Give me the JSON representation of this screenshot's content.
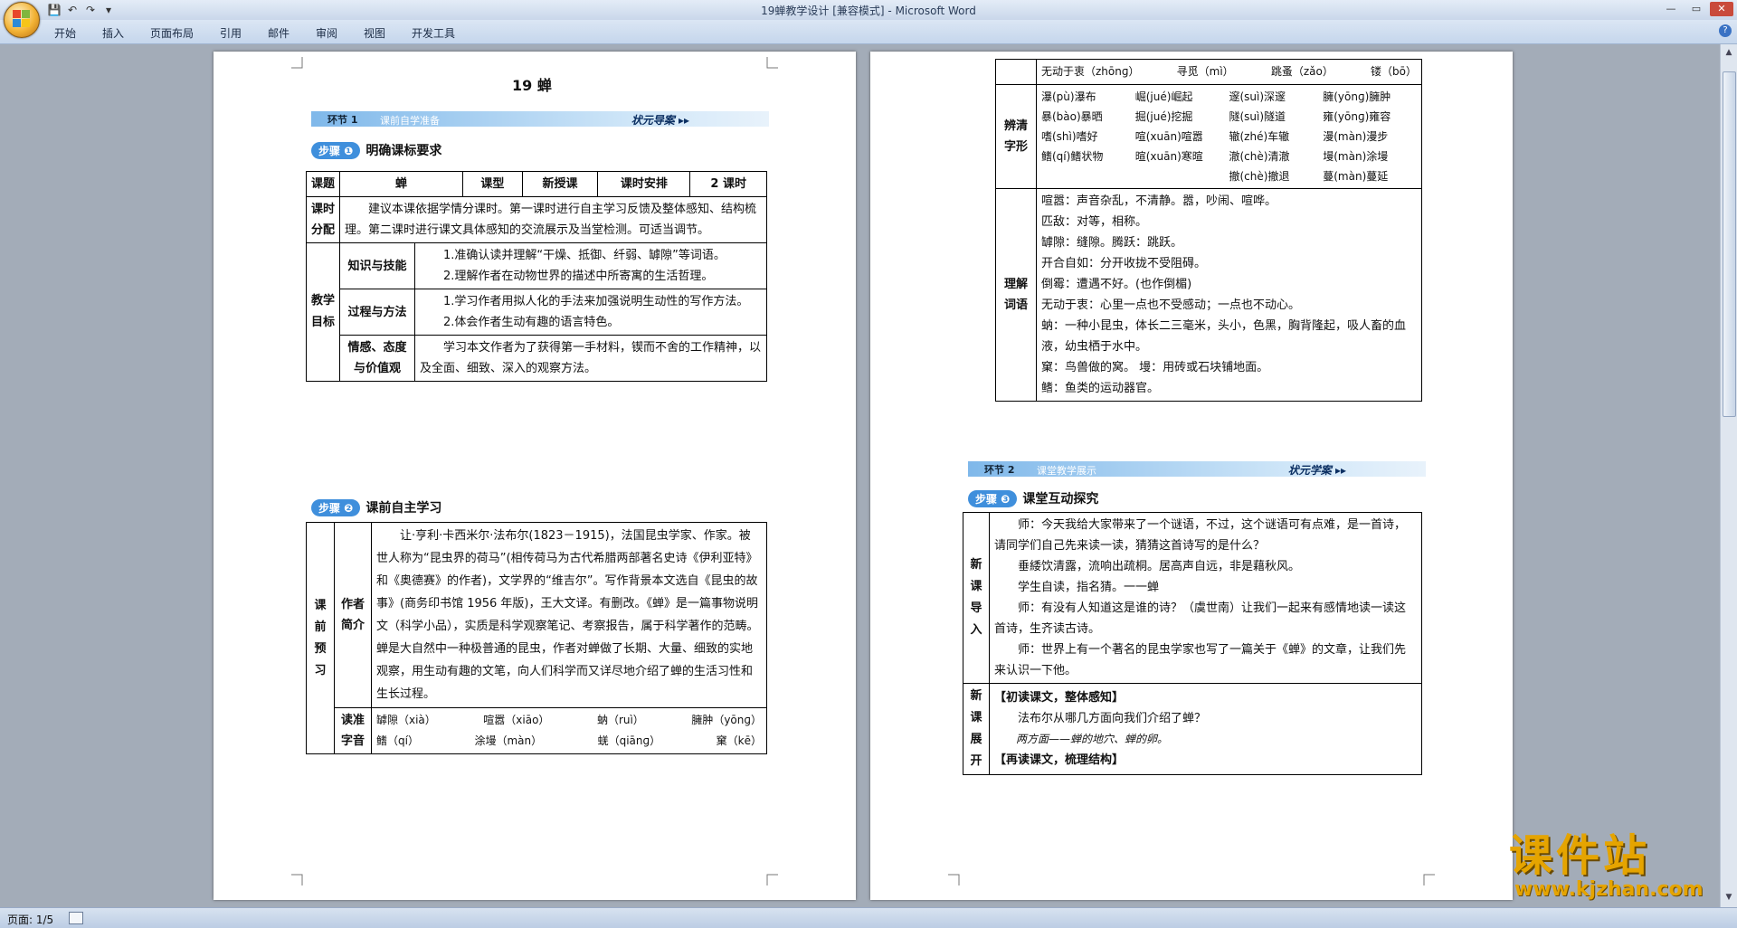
{
  "window": {
    "title": "19蝉教学设计 [兼容模式] - Microsoft Word",
    "qat": {
      "save": "💾",
      "undo": "↶",
      "redo": "↷",
      "more": "▾"
    },
    "controls": {
      "minimize": "—",
      "maximize": "▭",
      "close": "✕"
    }
  },
  "ribbon": {
    "tabs": [
      "开始",
      "插入",
      "页面布局",
      "引用",
      "邮件",
      "审阅",
      "视图",
      "开发工具"
    ],
    "help": "?"
  },
  "status": {
    "page": "页面: 1/5"
  },
  "watermark": {
    "line1": "课件站",
    "line2": "www.kjzhan.com"
  },
  "page1": {
    "title": "19 蝉",
    "banner1": {
      "ring": "环节 1",
      "text": "课前自学准备",
      "right": "状元导案 ▸▸"
    },
    "step1": {
      "pill": "步骤 ❶",
      "text": "明确课标要求"
    },
    "table1": {
      "row0": [
        "课题",
        "蝉",
        "课型",
        "新授课",
        "课时安排",
        "2 课时"
      ],
      "fen_label": "课时分配",
      "fen_text": "建议本课依据学情分课时。第一课时进行自主学习反馈及整体感知、结构梳理。第二课时进行课文具体感知的交流展示及当堂检测。可适当调节。",
      "goal_label": "教学目标",
      "k_label": "知识与技能",
      "k1": "1.准确认读并理解“干燥、抵御、纤弱、罅隙”等词语。",
      "k2": "2.理解作者在动物世界的描述中所寄寓的生活哲理。",
      "p_label": "过程与方法",
      "p1": "1.学习作者用拟人化的手法来加强说明生动性的写作方法。",
      "p2": "2.体会作者生动有趣的语言特色。",
      "e_label": "情感、态度与价值观",
      "e1": "学习本文作者为了获得第一手材料，锲而不舍的工作精神，以及全面、细致、深入的观察方法。"
    },
    "step2": {
      "pill": "步骤 ❷",
      "text": "课前自主学习"
    },
    "table2": {
      "pre_label": "课前预习",
      "author_label": "作者简介",
      "author_text": "让·亨利·卡西米尔·法布尔(1823－1915)，法国昆虫学家、作家。被世人称为“昆虫界的荷马”(相传荷马为古代希腊两部著名史诗《伊利亚特》和《奥德赛》的作者)，文学界的“维吉尔”。写作背景本文选自《昆虫的故事》(商务印书馆 1956 年版)，王大文译。有删改。《蝉》是一篇事物说明文（科学小品），实质是科学观察笔记、考察报告，属于科学著作的范畴。蝉是大自然中一种极普通的昆虫，作者对蝉做了长期、大量、细致的实地观察，用生动有趣的文笔，向人们科学而又详尽地介绍了蝉的生活习性和生长过程。",
      "read_label": "读准字音",
      "read_row1": [
        "罅隙（xià）",
        "喧嚣（xiāo）",
        "蚋（ruì）",
        "臃肿（yōnɡ）"
      ],
      "read_row2": [
        "鳍（qí）",
        "涂墁（màn）",
        "蜣（qiānɡ）",
        "窠（kē）"
      ]
    }
  },
  "page2": {
    "top_row": [
      "无动于衷（zhōnɡ）",
      "寻觅（mì）",
      "跳蚤（zǎo）",
      "镂（bō）"
    ],
    "bian_label": "辨清字形",
    "bian": [
      [
        "瀑(pù)瀑布",
        "崛(jué)崛起",
        "邃(suì)深邃",
        "臃(yōnɡ)臃肿"
      ],
      [
        "暴(bào)暴晒",
        "掘(jué)挖掘",
        "隧(suì)隧道",
        "雍(yōnɡ)雍容"
      ],
      [
        "嗜(shì)嗜好",
        "喧(xuān)喧嚣",
        "辙(zhé)车辙",
        "漫(màn)漫步"
      ],
      [
        "鳍(qí)鳍状物",
        "暄(xuān)寒暄",
        "澈(chè)清澈",
        "墁(màn)涂墁"
      ],
      [
        "",
        "",
        "撤(chè)撤退",
        "蔓(màn)蔓延"
      ]
    ],
    "li_label": "理解词语",
    "li": [
      "喧嚣：声音杂乱，不清静。嚣，吵闹、喧哗。",
      "匹敌：对等，相称。",
      "罅隙：缝隙。腾跃：跳跃。",
      "开合自如：分开收拢不受阻碍。",
      "倒霉：遭遇不好。(也作倒楣)",
      "无动于衷：心里一点也不受感动；一点也不动心。",
      "蚋：一种小昆虫，体长二三毫米，头小，色黑，胸背隆起，吸人畜的血液，幼虫栖于水中。",
      "窠：鸟兽做的窝。  墁：用砖或石块铺地面。",
      "鳍：鱼类的运动器官。"
    ],
    "banner2": {
      "ring": "环节 2",
      "text": "课堂教学展示",
      "right": "状元学案 ▸▸"
    },
    "step3": {
      "pill": "步骤 ❸",
      "text": "课堂互动探究"
    },
    "table3": {
      "intro_label": "新课导入",
      "intro": [
        "师：今天我给大家带来了一个谜语，不过，这个谜语可有点难，是一首诗，请同学们自己先来读一读，猜猜这首诗写的是什么？",
        "垂緌饮清露，流响出疏桐。居高声自远，非是藉秋风。",
        "学生自读，指名猜。一一蝉",
        "师：有没有人知道这是谁的诗？（虞世南）让我们一起来有感情地读一读这首诗，生齐读古诗。",
        "师：世界上有一个著名的昆虫学家也写了一篇关于《蝉》的文章，让我们先来认识一下他。"
      ],
      "dev_label": "新课展开",
      "dev": [
        "【初读课文，整体感知】",
        "法布尔从哪几方面向我们介绍了蝉？",
        "两方面——蝉的地穴、蝉的卵。",
        "【再读课文，梳理结构】"
      ]
    }
  }
}
